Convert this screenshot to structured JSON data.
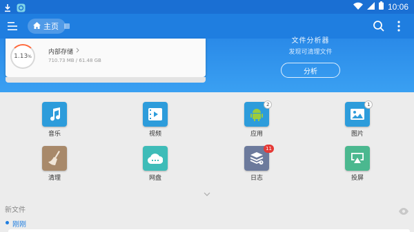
{
  "status_bar": {
    "time": "10:06"
  },
  "header": {
    "breadcrumb_label": "主页"
  },
  "storage": {
    "percent": "1.13",
    "percent_sign": "%",
    "title": "内部存储",
    "size": "710.73 MB / 61.48 GB"
  },
  "analyze": {
    "title": "文件分析器",
    "subtitle": "发现可清理文件",
    "button_label": "分析"
  },
  "categories": [
    {
      "label": "音乐",
      "icon": "music-icon",
      "color": "#2d9cdb"
    },
    {
      "label": "视频",
      "icon": "video-icon",
      "color": "#2d9cdb"
    },
    {
      "label": "应用",
      "icon": "android-icon",
      "color": "#2d9cdb",
      "badge": "2"
    },
    {
      "label": "图片",
      "icon": "image-icon",
      "color": "#2d9cdb",
      "badge": "1"
    },
    {
      "label": "清理",
      "icon": "broom-icon",
      "color": "#a8896a"
    },
    {
      "label": "网盘",
      "icon": "cloud-icon",
      "color": "#3ebcb8"
    },
    {
      "label": "日志",
      "icon": "log-icon",
      "color": "#6c7a9c",
      "badge": "11"
    },
    {
      "label": "投屏",
      "icon": "cast-icon",
      "color": "#4bb88f"
    }
  ],
  "new_files": {
    "title": "新文件",
    "group_label": "刚刚"
  },
  "colors": {
    "primary": "#1f7ee0",
    "badge_red": "#e53935"
  }
}
